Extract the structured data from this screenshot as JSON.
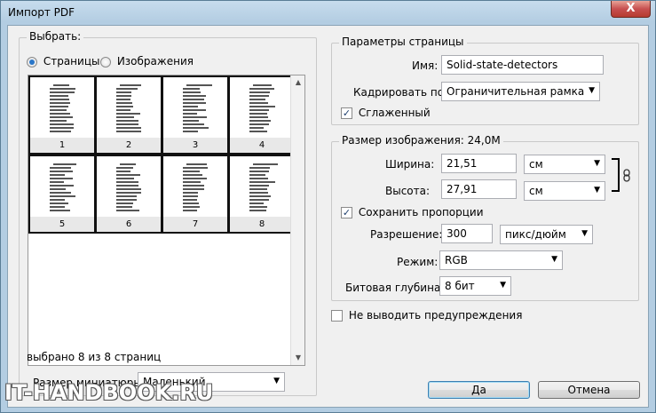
{
  "window": {
    "title": "Импорт PDF",
    "close_label": "X"
  },
  "select_group": {
    "title": "Выбрать:",
    "radio_pages": "Страницы",
    "radio_images": "Изображения",
    "thumbnails": [
      "1",
      "2",
      "3",
      "4",
      "5",
      "6",
      "7",
      "8"
    ],
    "selected_count": "выбрано 8 из 8 страниц",
    "thumb_size_label": "Размер миниатюры:",
    "thumb_size_value": "Маленький"
  },
  "page_params": {
    "title": "Параметры страницы",
    "name_label": "Имя:",
    "name_value": "Solid-state-detectors",
    "crop_label": "Кадрировать по:",
    "crop_value": "Ограничительная рамка",
    "antialias_label": "Сглаженный",
    "antialias_checked": true
  },
  "image_size": {
    "title": "Размер изображения: 24,0M",
    "width_label": "Ширина:",
    "width_value": "21,51",
    "width_unit": "см",
    "height_label": "Высота:",
    "height_value": "27,91",
    "height_unit": "см",
    "constrain_label": "Сохранить пропорции",
    "constrain_checked": true,
    "resolution_label": "Разрешение:",
    "resolution_value": "300",
    "resolution_unit": "пикс/дюйм",
    "mode_label": "Режим:",
    "mode_value": "RGB",
    "depth_label": "Битовая глубина:",
    "depth_value": "8 бит"
  },
  "suppress_warnings_label": "Не выводить предупреждения",
  "buttons": {
    "ok": "Да",
    "cancel": "Отмена"
  },
  "watermark": "IT-HANDBOOK.RU",
  "icons": {
    "link": "chain-link-icon",
    "dropdown": "chevron-down-icon"
  }
}
